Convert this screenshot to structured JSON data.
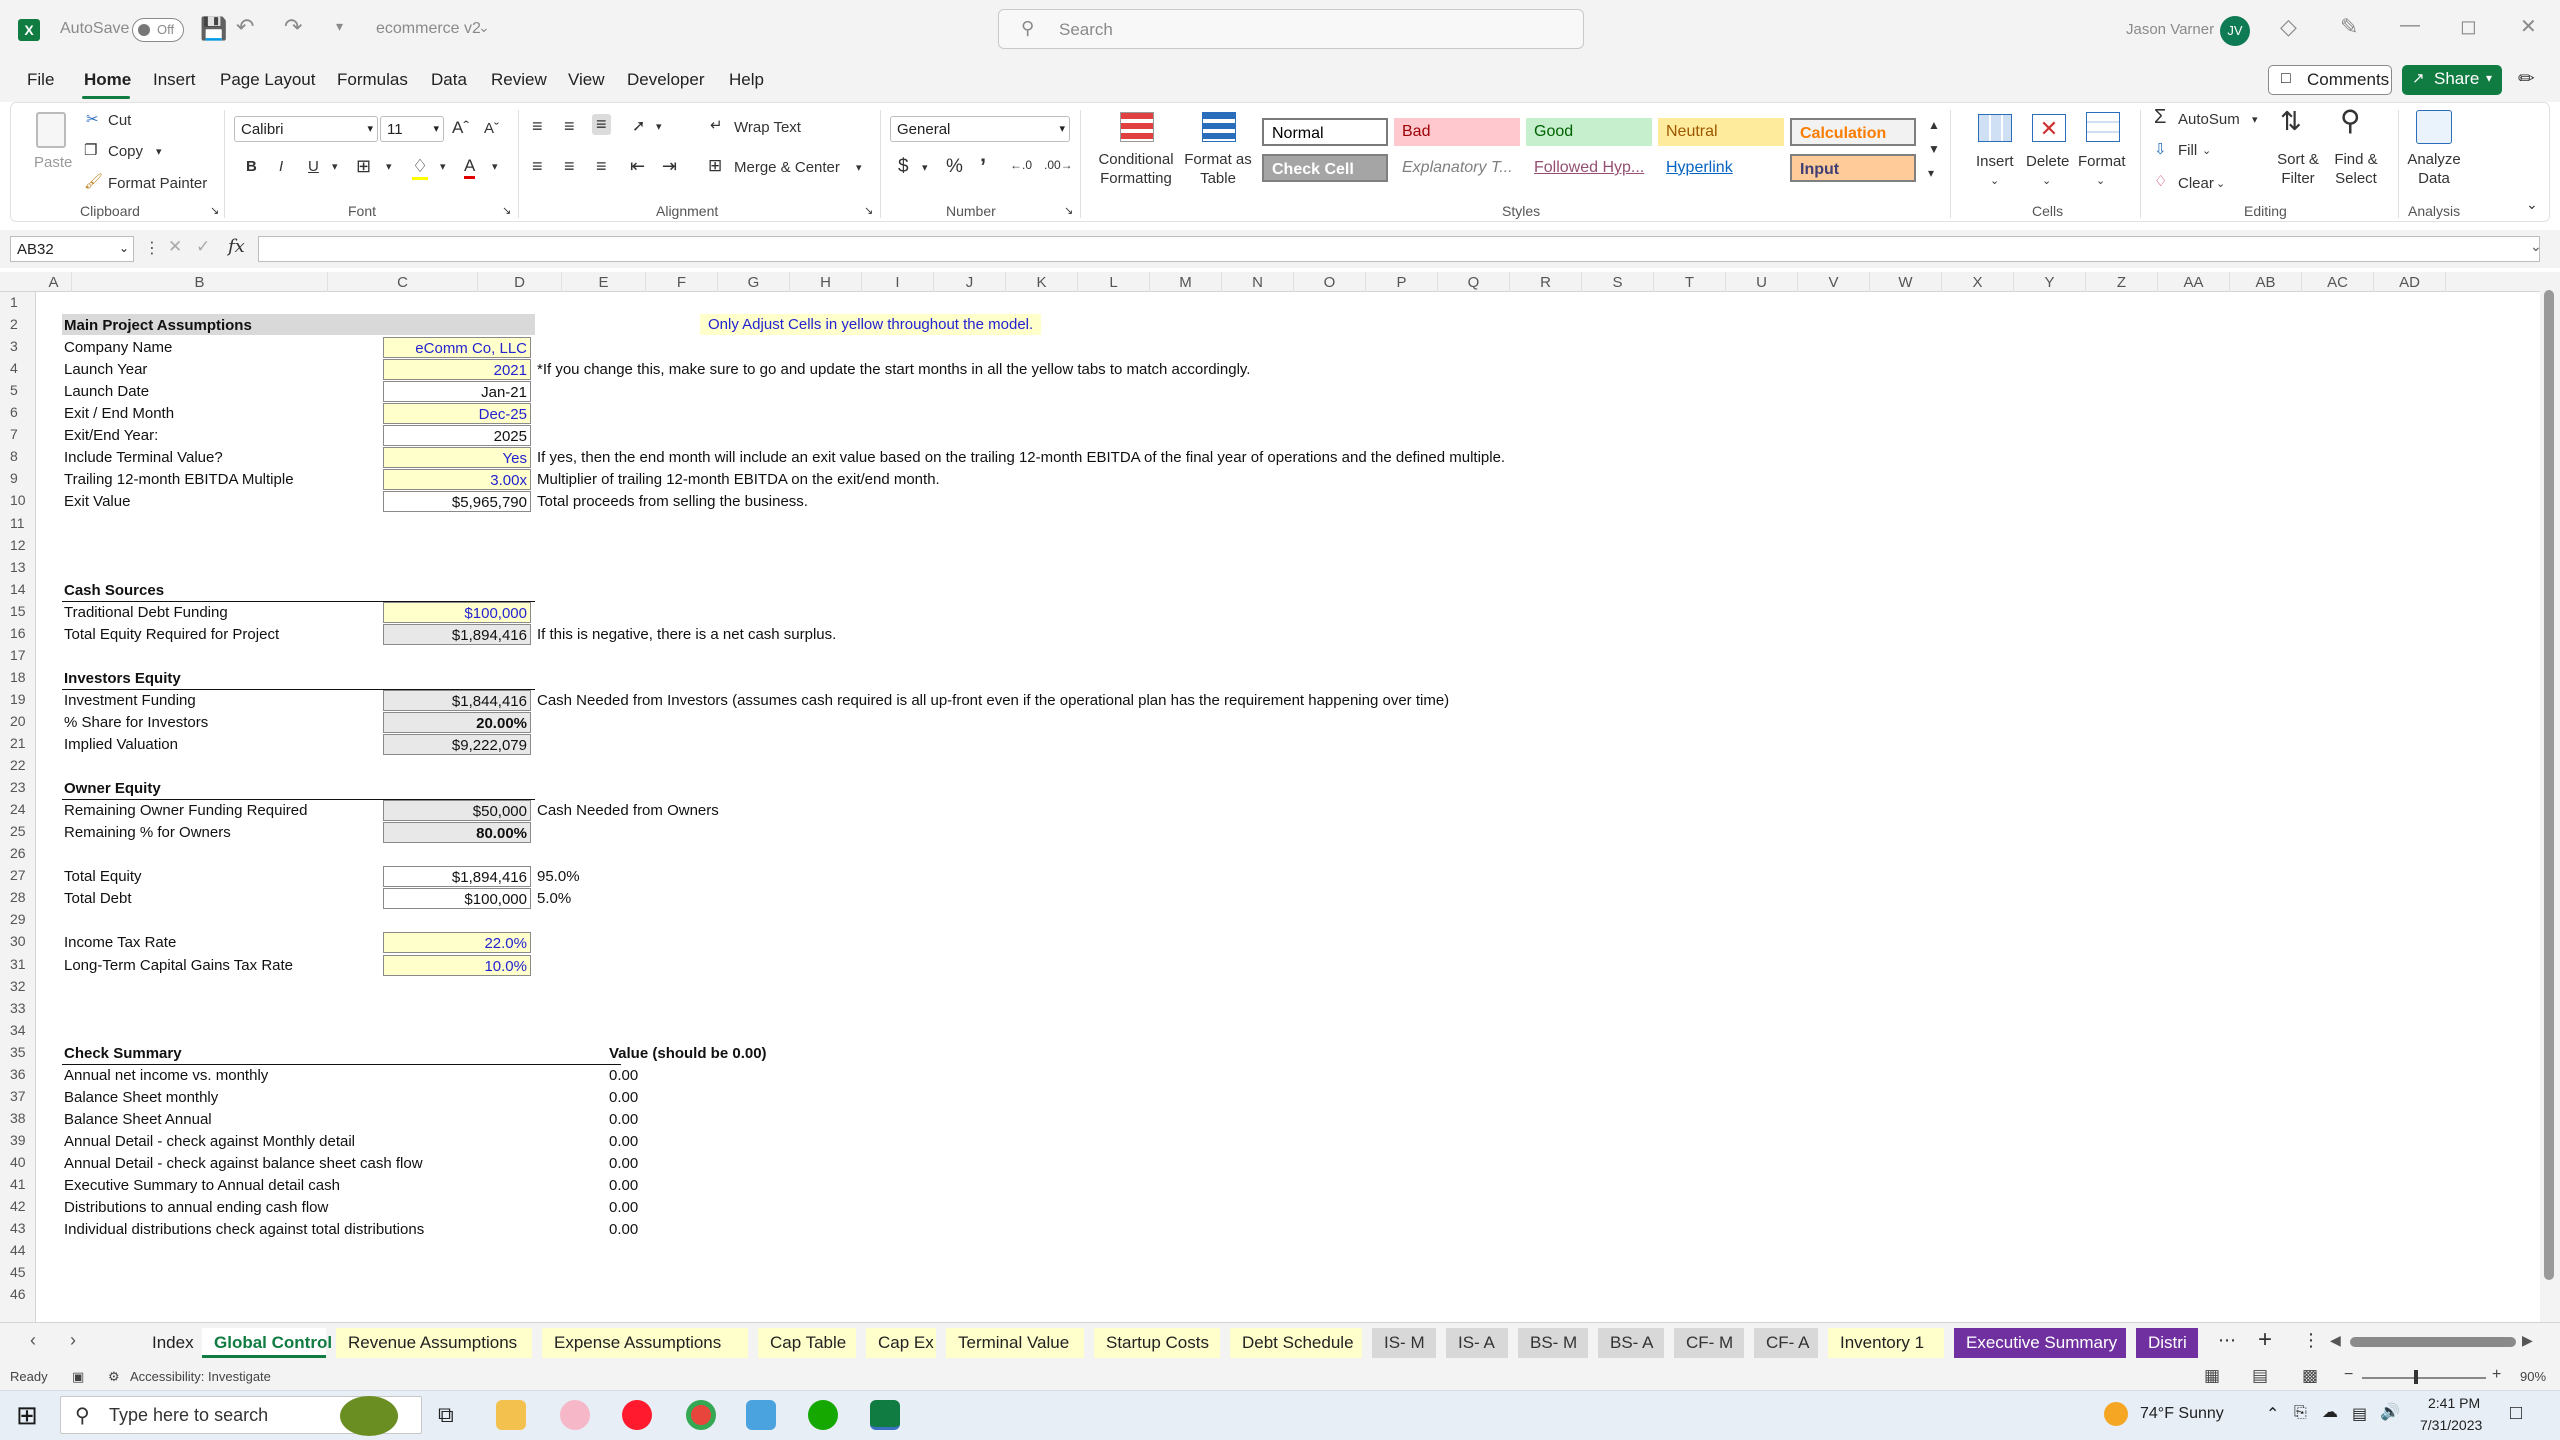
{
  "titlebar": {
    "autosave_label": "AutoSave",
    "autosave_state": "Off",
    "file_name": "ecommerce v2",
    "search_placeholder": "Search",
    "user_name": "Jason Varner",
    "user_initials": "JV"
  },
  "menu": {
    "items": [
      "File",
      "Home",
      "Insert",
      "Page Layout",
      "Formulas",
      "Data",
      "Review",
      "View",
      "Developer",
      "Help"
    ],
    "active": "Home",
    "comments_label": "Comments",
    "share_label": "Share"
  },
  "ribbon": {
    "clipboard": {
      "paste": "Paste",
      "cut": "Cut",
      "copy": "Copy",
      "format_painter": "Format Painter",
      "label": "Clipboard"
    },
    "font": {
      "name": "Calibri",
      "size": "11",
      "label": "Font"
    },
    "alignment": {
      "wrap_text": "Wrap Text",
      "merge_center": "Merge & Center",
      "label": "Alignment"
    },
    "number": {
      "format": "General",
      "label": "Number"
    },
    "styles": {
      "conditional": "Conditional Formatting",
      "format_table": "Format as Table",
      "cells": [
        {
          "name": "Normal",
          "bg": "#ffffff",
          "fg": "#000000"
        },
        {
          "name": "Bad",
          "bg": "#ffc7ce",
          "fg": "#9c0006"
        },
        {
          "name": "Good",
          "bg": "#c6efce",
          "fg": "#006100"
        },
        {
          "name": "Neutral",
          "bg": "#ffeb9c",
          "fg": "#9c5700"
        },
        {
          "name": "Calculation",
          "bg": "#f2f2f2",
          "fg": "#fa7d00"
        },
        {
          "name": "Check Cell",
          "bg": "#a5a5a5",
          "fg": "#ffffff"
        },
        {
          "name": "Explanatory T...",
          "bg": "#ffffff",
          "fg": "#7f7f7f"
        },
        {
          "name": "Followed Hyp...",
          "bg": "#ffffff",
          "fg": "#954f72"
        },
        {
          "name": "Hyperlink",
          "bg": "#ffffff",
          "fg": "#0563c1"
        },
        {
          "name": "Input",
          "bg": "#ffcc99",
          "fg": "#3f3f76"
        }
      ],
      "label": "Styles"
    },
    "cells": {
      "insert": "Insert",
      "delete": "Delete",
      "format": "Format",
      "label": "Cells"
    },
    "editing": {
      "autosum": "AutoSum",
      "fill": "Fill",
      "clear": "Clear",
      "sort_filter": "Sort & Filter",
      "find_select": "Find & Select",
      "label": "Editing"
    },
    "analysis": {
      "analyze_data": "Analyze Data",
      "label": "Analysis"
    }
  },
  "formula_bar": {
    "name_box": "AB32",
    "fx": "fx",
    "content": ""
  },
  "columns": [
    "A",
    "B",
    "C",
    "D",
    "E",
    "F",
    "G",
    "H",
    "I",
    "J",
    "K",
    "L",
    "M",
    "N",
    "O",
    "P",
    "Q",
    "R",
    "S",
    "T",
    "U",
    "V",
    "W",
    "X",
    "Y",
    "Z",
    "AA",
    "AB",
    "AC",
    "AD"
  ],
  "rows": [
    "1",
    "2",
    "3",
    "4",
    "5",
    "6",
    "7",
    "8",
    "9",
    "10",
    "11",
    "12",
    "13",
    "14",
    "15",
    "16",
    "17",
    "18",
    "19",
    "20",
    "21",
    "22",
    "23",
    "24",
    "25",
    "26",
    "27",
    "28",
    "29",
    "30",
    "31",
    "32",
    "33",
    "34",
    "35",
    "36",
    "37",
    "38",
    "39",
    "40",
    "41",
    "42",
    "43",
    "44",
    "45",
    "46"
  ],
  "sheet": {
    "banner_note": "Only Adjust Cells in yellow throughout the model.",
    "main_header": "Main Project Assumptions",
    "main_rows": [
      {
        "label": "Company Name",
        "value": "eComm Co, LLC",
        "style": "yellow",
        "note": ""
      },
      {
        "label": "Launch Year",
        "value": "2021",
        "style": "yellow",
        "note": "*If you change this, make sure to go and update the start months in all the yellow tabs to match accordingly."
      },
      {
        "label": "Launch Date",
        "value": "Jan-21",
        "style": "white",
        "note": ""
      },
      {
        "label": "Exit / End Month",
        "value": "Dec-25",
        "style": "yellow",
        "note": ""
      },
      {
        "label": "Exit/End Year:",
        "value": "2025",
        "style": "white",
        "note": ""
      },
      {
        "label": "Include Terminal Value?",
        "value": "Yes",
        "style": "yellow",
        "note": "If yes, then the end month will include an exit value based on the trailing 12-month EBITDA of the final year of operations and the defined multiple."
      },
      {
        "label": "Trailing 12-month EBITDA Multiple",
        "value": "3.00x",
        "style": "yellow",
        "note": "Multiplier of trailing 12-month EBITDA on the exit/end month."
      },
      {
        "label": "Exit Value",
        "value": "$5,965,790",
        "style": "white",
        "note": "Total proceeds from selling the business."
      }
    ],
    "cash_header": "Cash Sources",
    "cash_rows": [
      {
        "label": "Traditional Debt Funding",
        "value": "$100,000",
        "style": "yellow",
        "note": ""
      },
      {
        "label": "Total Equity Required for Project",
        "value": "$1,894,416",
        "style": "gray",
        "note": "If this is negative, there is a net cash surplus."
      }
    ],
    "investors_header": "Investors Equity",
    "investors_rows": [
      {
        "label": "Investment Funding",
        "value": "$1,844,416",
        "style": "gray",
        "note": "Cash Needed from Investors (assumes cash required is all up-front even if the operational plan has the requirement happening over time)"
      },
      {
        "label": "% Share for Investors",
        "value": "20.00%",
        "style": "gray bold",
        "note": ""
      },
      {
        "label": "Implied Valuation",
        "value": "$9,222,079",
        "style": "gray",
        "note": ""
      }
    ],
    "owner_header": "Owner Equity",
    "owner_rows": [
      {
        "label": "Remaining Owner Funding Required",
        "value": "$50,000",
        "style": "gray",
        "note": "Cash Needed from Owners"
      },
      {
        "label": "Remaining % for Owners",
        "value": "80.00%",
        "style": "gray bold",
        "note": ""
      }
    ],
    "totals_rows": [
      {
        "label": "Total Equity",
        "value": "$1,894,416",
        "style": "white",
        "note": "95.0%"
      },
      {
        "label": "Total Debt",
        "value": "$100,000",
        "style": "white",
        "note": "5.0%"
      }
    ],
    "tax_rows": [
      {
        "label": "Income Tax Rate",
        "value": "22.0%",
        "style": "yellow",
        "note": ""
      },
      {
        "label": "Long-Term Capital Gains Tax Rate",
        "value": "10.0%",
        "style": "yellow",
        "note": ""
      }
    ],
    "check_header": "Check Summary",
    "check_value_header": "Value (should be 0.00)",
    "check_rows": [
      {
        "label": "Annual net income vs. monthly",
        "value": "0.00"
      },
      {
        "label": "Balance Sheet monthly",
        "value": "0.00"
      },
      {
        "label": "Balance Sheet Annual",
        "value": "0.00"
      },
      {
        "label": "Annual Detail - check against Monthly detail",
        "value": "0.00"
      },
      {
        "label": "Annual Detail - check against balance sheet cash flow",
        "value": "0.00"
      },
      {
        "label": "Executive Summary to Annual detail cash",
        "value": "0.00"
      },
      {
        "label": "Distributions to annual ending cash flow",
        "value": "0.00"
      },
      {
        "label": "Individual distributions check against total distributions",
        "value": "0.00"
      }
    ]
  },
  "tabs": [
    {
      "name": "Index",
      "style": "plain"
    },
    {
      "name": "Global Control",
      "style": "act"
    },
    {
      "name": "Revenue Assumptions",
      "style": "yel"
    },
    {
      "name": "Expense Assumptions",
      "style": "yel"
    },
    {
      "name": "Cap Table",
      "style": "yel"
    },
    {
      "name": "Cap Ex",
      "style": "yel"
    },
    {
      "name": "Terminal Value",
      "style": "yel"
    },
    {
      "name": "Startup Costs",
      "style": "yel"
    },
    {
      "name": "Debt Schedule",
      "style": "yel"
    },
    {
      "name": "IS- M",
      "style": "gry"
    },
    {
      "name": "IS- A",
      "style": "gry"
    },
    {
      "name": "BS- M",
      "style": "gry"
    },
    {
      "name": "BS- A",
      "style": "gry"
    },
    {
      "name": "CF- M",
      "style": "gry"
    },
    {
      "name": "CF- A",
      "style": "gry"
    },
    {
      "name": "Inventory 1",
      "style": "yel"
    },
    {
      "name": "Executive Summary",
      "style": "pur"
    },
    {
      "name": "Distri",
      "style": "pur"
    }
  ],
  "status": {
    "ready": "Ready",
    "accessibility": "Accessibility: Investigate",
    "zoom": "90%"
  },
  "taskbar": {
    "search_placeholder": "Type here to search",
    "weather": "74°F  Sunny",
    "time": "2:41 PM",
    "date": "7/31/2023"
  }
}
